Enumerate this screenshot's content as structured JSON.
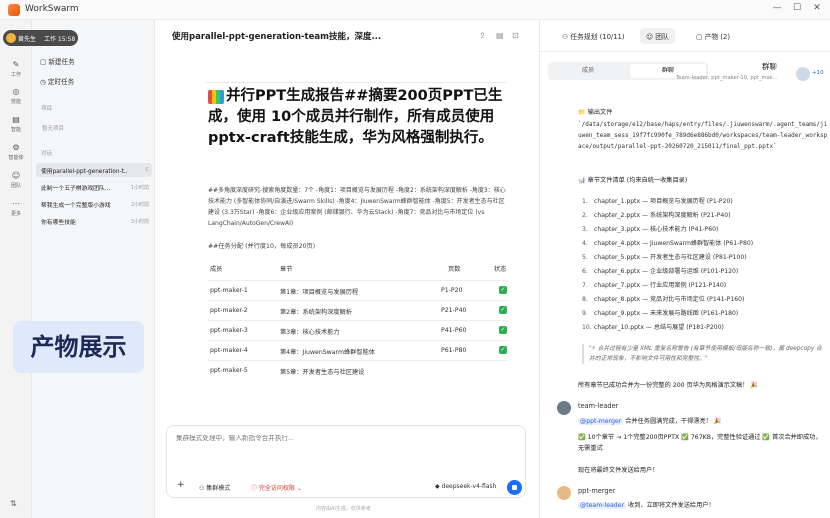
{
  "window": {
    "title": "WorkSwarm",
    "minimize": "—",
    "maximize": "☐",
    "close": "✕"
  },
  "rail": {
    "items": [
      {
        "icon": "✎",
        "label": "工作"
      },
      {
        "icon": "◎",
        "label": "技能"
      },
      {
        "icon": "▤",
        "label": "智能"
      },
      {
        "icon": "⚙",
        "label": "智能体"
      },
      {
        "icon": "☺",
        "label": "团队"
      },
      {
        "icon": "⋯",
        "label": "更多"
      }
    ],
    "toggle": "⇅"
  },
  "user": {
    "name": "黄先生",
    "status": "工作 15:58"
  },
  "sidebar": {
    "new_task": "新建任务",
    "scheduled": "定时任务",
    "projects_header": "项目",
    "projects_empty": "暂无项目",
    "chats_header": "对话",
    "chats": [
      {
        "title": "使用parallel-ppt-generation-t...",
        "time": "C",
        "active": true
      },
      {
        "title": "此制一个五子棋游戏团队...",
        "time": "1小时前",
        "active": false
      },
      {
        "title": "帮我生成一个完整版小游戏",
        "time": "2小时前",
        "active": false
      },
      {
        "title": "你有哪些技能",
        "time": "3小时前",
        "active": false
      }
    ]
  },
  "overlay_caption": "产物展示",
  "doc": {
    "title": "使用parallel-ppt-generation-team技能，深度...",
    "actions": [
      "⇪",
      "▤",
      "⊡"
    ],
    "heading": "并行PPT生成报告##摘要200页PPT已生成，使用 10个成员并行制作，所有成员使用pptx-craft技能生成，华为风格强制执行。",
    "dimensions_text": "##多角度深度研究-搜索角度数量：7个 -角度1：项目概览与发展历程 -角度2：系统架构深度解析 -角度3：核心技术能力 (多智能体协同/自演进/Swarm Skills) -角度4：JiuwenSwarm蜂群智能体 -角度5：开发者生态与社区建设 (3.3万Star) -角度6：企业级应用案例 (邮储银行、华为云Stack) -角度7：竞品对比与市场定位 (vs LangChain/AutoGen/CrewAI)",
    "assign_title": "##任务分配 (并行度10，每成员20页)",
    "table": {
      "headers": [
        "成员",
        "章节",
        "页数",
        "状态"
      ],
      "rows": [
        {
          "member": "ppt-maker-1",
          "chapter": "第1章：项目概览与发展历程",
          "pages": "P1-P20"
        },
        {
          "member": "ppt-maker-2",
          "chapter": "第2章：系统架构深度解析",
          "pages": "P21-P40"
        },
        {
          "member": "ppt-maker-3",
          "chapter": "第3章：核心技术能力",
          "pages": "P41-P60"
        },
        {
          "member": "ppt-maker-4",
          "chapter": "第4章：JiuwenSwarm蜂群智能体",
          "pages": "P61-P80"
        },
        {
          "member": "ppt-maker-5",
          "chapter": "第5章：开发者生态与社区建设",
          "pages": ""
        }
      ],
      "status_icon": "✓"
    }
  },
  "input": {
    "placeholder": "集群模式处理中，输入新指令合并执行...",
    "add": "+",
    "mode": "集群模式",
    "permission": "完全访问权限",
    "model": "deepseek-v4-flash"
  },
  "disclaimer": "内容由AI生成，仅供参考",
  "right": {
    "tabs": [
      {
        "icon": "⚇",
        "label": "任务规划 (10/11)"
      },
      {
        "icon": "☺",
        "label": "团队"
      },
      {
        "icon": "▢",
        "label": "产物 (2)"
      }
    ],
    "segments": [
      "成员",
      "群聊"
    ],
    "group": {
      "label": "群聊",
      "members": "Team-leader, ppt_maker-10, ppt_mak...",
      "count": "+10"
    },
    "output_label": "📁 输出文件",
    "output_path": "`/data/storage/e12/base/haps/entry/files/.jiuwenswarm/.agent_teams/jiuwen_team_sess_19f7fc990fe_789d6e886bd0/workspaces/team-leader_workspace/output/parallel-ppt-20260720_215011/final_ppt.pptx`",
    "chapter_label": "📊 章节文件清单 (均来自统一收集目录)",
    "chapters": [
      "chapter_1.pptx — 项目概览与发展历程 (P1-P20)",
      "chapter_2.pptx — 系统架构深度解析 (P21-P40)",
      "chapter_3.pptx — 核心技术能力 (P41-P60)",
      "chapter_4.pptx — JiuwenSwarm蜂群智能体 (P61-P80)",
      "chapter_5.pptx — 开发者生态与社区建设 (P81-P100)",
      "chapter_6.pptx — 企业级部署与运维 (P101-P120)",
      "chapter_7.pptx — 行业应用案例 (P121-P140)",
      "chapter_8.pptx — 竞品对比与市场定位 (P141-P160)",
      "chapter_9.pptx — 未来发展与路线图 (P161-P180)",
      "chapter_10.pptx — 总结与展望 (P181-P200)"
    ],
    "quote": "\"⚡ 合并过程有少量 XML 重复名称警告 (有章节使用模板/母版名称一致)，属 deepcopy 合并的正常现象，不影响文件可用性和完整性。\"",
    "merged_note": "所有章节已成功合并为一份完整的 200 页华为风格演示文稿！ 🎉",
    "messages": [
      {
        "name": "team-leader",
        "mention": "@ppt-merger",
        "line1": "合并任务圆满完成，干得漂亮！ 🎉",
        "line2": "✅ 10个章节 → 1个完整200页PPTX ✅ 767KB，完整性验证通过 ✅ 首次合并即成功，无需重试",
        "line3": "现在将最终文件发送给用户！"
      },
      {
        "name": "ppt-merger",
        "mention": "@team-leader",
        "line1": "收到，立即将文件发送给用户！"
      }
    ]
  }
}
